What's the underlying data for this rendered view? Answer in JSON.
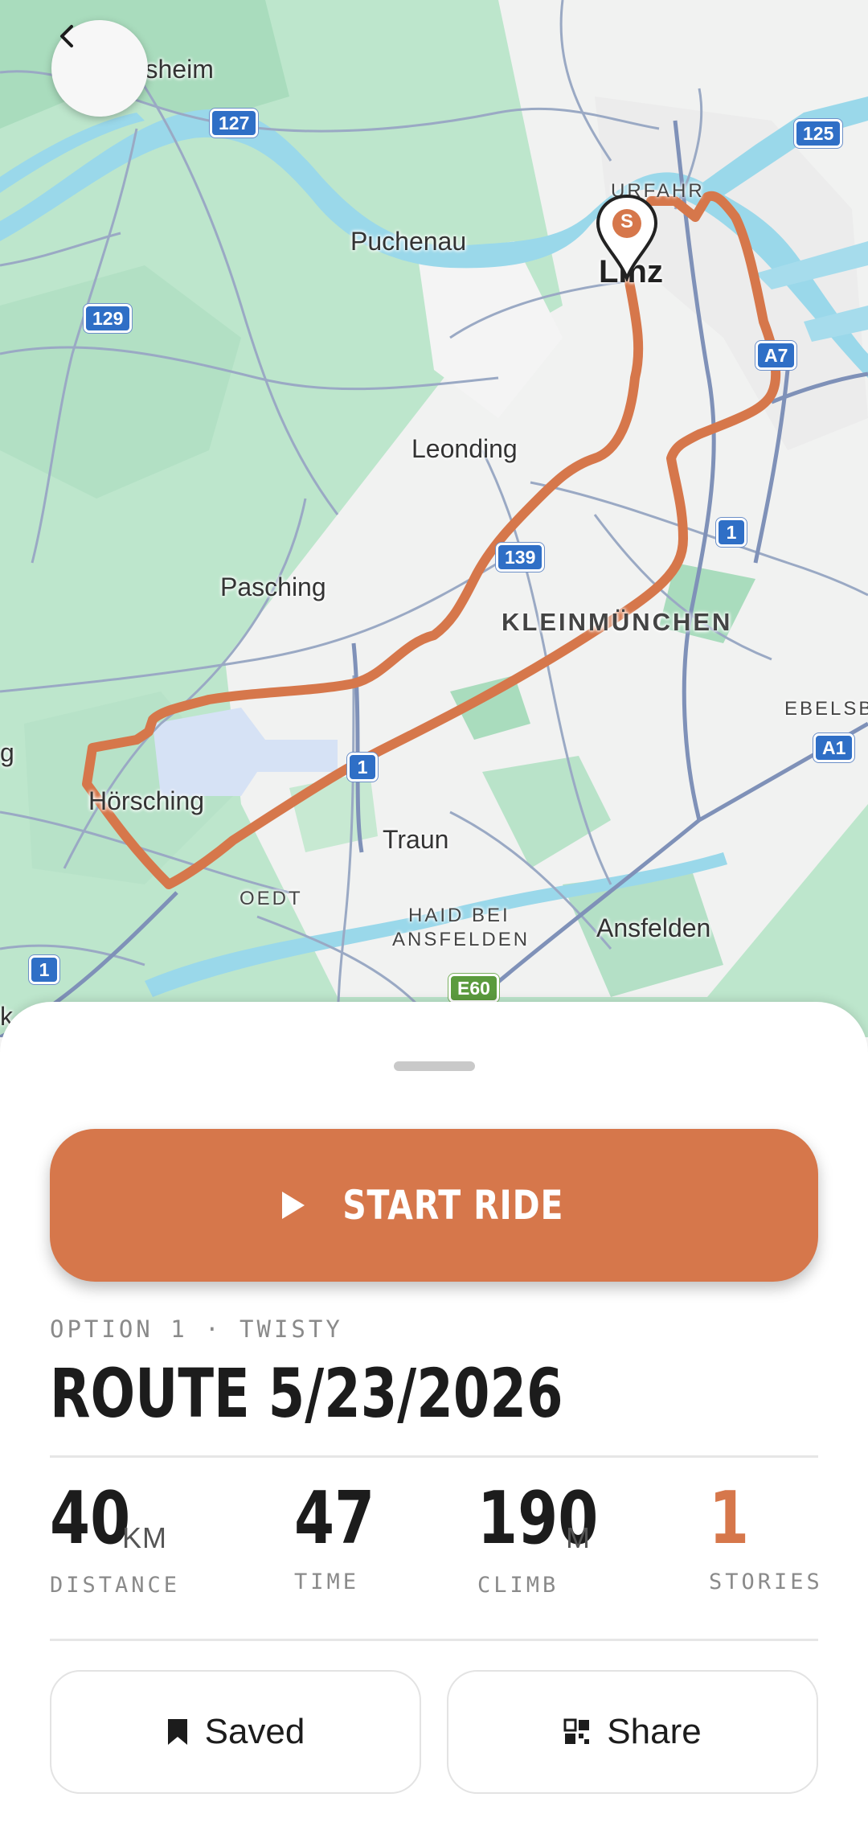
{
  "map": {
    "back_button_icon": "chevron-left-icon",
    "start_marker_letter": "S",
    "route_color": "#d6774b",
    "labels": {
      "ottensheim": "tensheim",
      "puchenau": "Puchenau",
      "urfahr": "URFAHR",
      "linz": "Linz",
      "leonding": "Leonding",
      "pasching": "Pasching",
      "kleinmuenchen": "KLEINMÜNCHEN",
      "ebelsberg": "EBELSB",
      "hoersching": "Hörsching",
      "traun": "Traun",
      "oedt": "OEDT",
      "haid_line1": "HAID BEI",
      "haid_line2": "ANSFELDEN",
      "ansfelden": "Ansfelden",
      "edge_g": "g",
      "edge_k": "k"
    },
    "shields": {
      "r127": "127",
      "r125": "125",
      "r129": "129",
      "a7": "A7",
      "r139": "139",
      "r1_east": "1",
      "a1": "A1",
      "r1_mid": "1",
      "r1_west": "1",
      "e60": "E60"
    }
  },
  "sheet": {
    "start_button_label": "START RIDE",
    "start_button_icon": "play-icon",
    "option_label": "OPTION 1 · TWISTY",
    "route_title": "ROUTE 5/23/2026",
    "stats": {
      "distance": {
        "value": "40",
        "unit": "KM",
        "label": "DISTANCE"
      },
      "time": {
        "value": "47",
        "label": "TIME"
      },
      "climb": {
        "value": "190",
        "unit": "M",
        "label": "CLIMB"
      },
      "stories": {
        "value": "1",
        "label": "STORIES",
        "color": "#d6774b"
      }
    },
    "saved_button": {
      "label": "Saved",
      "icon": "bookmark-icon"
    },
    "share_button": {
      "label": "Share",
      "icon": "qr-code-icon"
    }
  }
}
